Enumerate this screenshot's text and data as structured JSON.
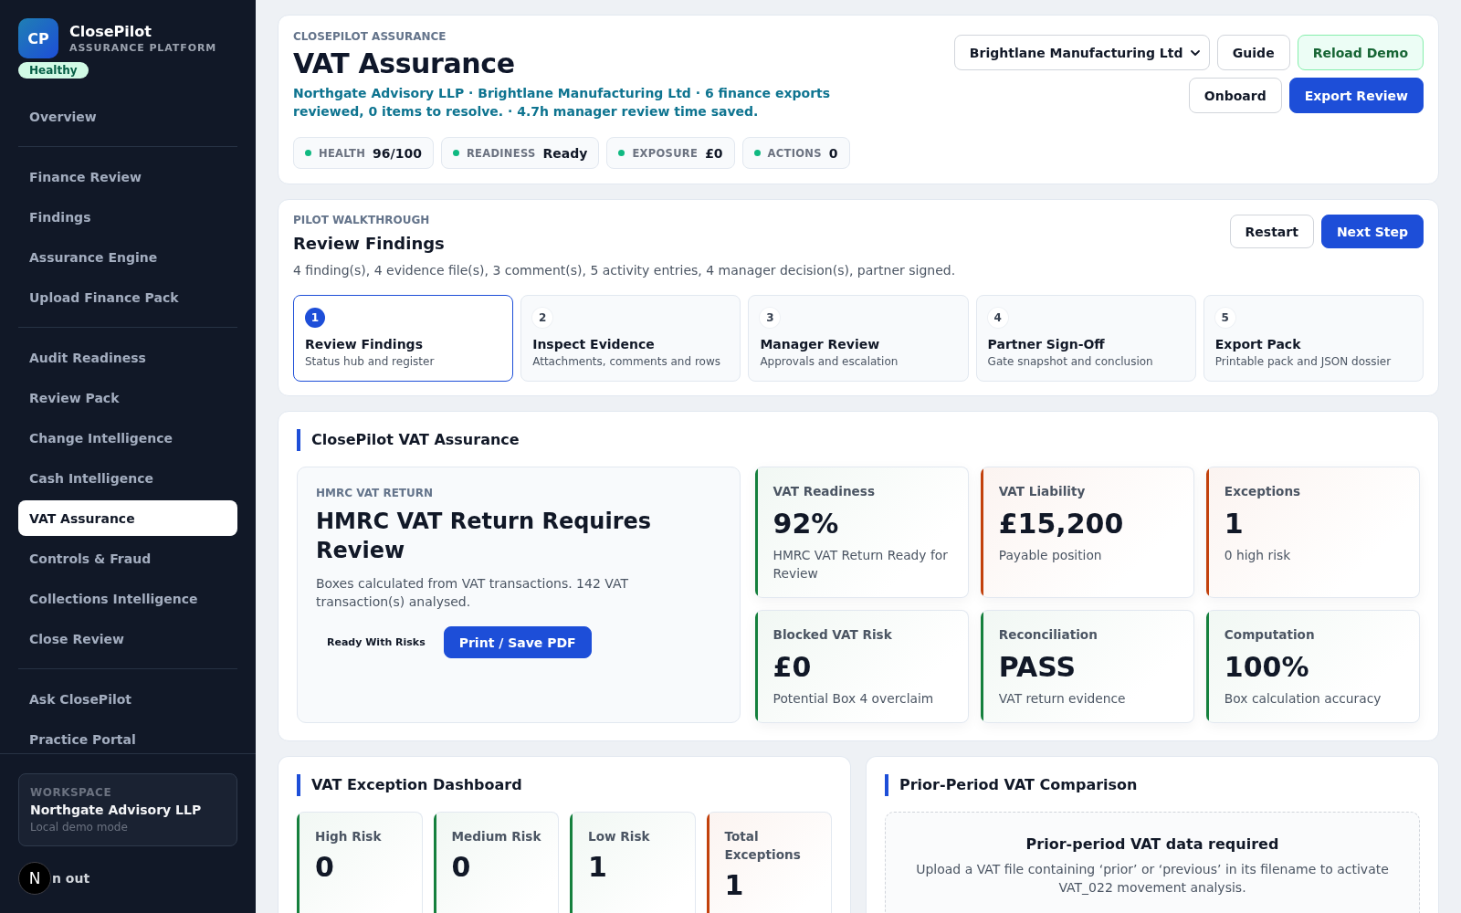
{
  "sidebar": {
    "logo": "CP",
    "brand": "ClosePilot",
    "tagline": "ASSURANCE PLATFORM",
    "status_badge": "Healthy",
    "nav_sections": [
      {
        "items": [
          {
            "label": "Overview",
            "selected": false
          }
        ]
      },
      {
        "items": [
          {
            "label": "Finance Review",
            "selected": false
          },
          {
            "label": "Findings",
            "selected": false
          },
          {
            "label": "Assurance Engine",
            "selected": false
          },
          {
            "label": "Upload Finance Pack",
            "selected": false
          }
        ]
      },
      {
        "items": [
          {
            "label": "Audit Readiness",
            "selected": false
          },
          {
            "label": "Review Pack",
            "selected": false
          },
          {
            "label": "Change Intelligence",
            "selected": false
          },
          {
            "label": "Cash Intelligence",
            "selected": false
          },
          {
            "label": "VAT Assurance",
            "selected": true
          },
          {
            "label": "Controls & Fraud",
            "selected": false
          },
          {
            "label": "Collections Intelligence",
            "selected": false
          },
          {
            "label": "Close Review",
            "selected": false
          }
        ]
      },
      {
        "items": [
          {
            "label": "Ask ClosePilot",
            "selected": false
          },
          {
            "label": "Practice Portal",
            "selected": false
          }
        ]
      }
    ],
    "workspace": {
      "label": "WORKSPACE",
      "name": "Northgate Advisory LLP",
      "mode": "Local demo mode"
    },
    "dev_tools_badge": "N",
    "sign_out": "n out"
  },
  "header": {
    "eyebrow": "CLOSEPILOT ASSURANCE",
    "title": "VAT Assurance",
    "summary": "Northgate Advisory LLP · Brightlane Manufacturing Ltd · 6 finance exports reviewed, 0 items to resolve. · 4.7h manager review time saved.",
    "company_select": {
      "value": "Brightlane Manufacturing Ltd"
    },
    "actions": [
      {
        "label": "Guide",
        "kind": "secondary"
      },
      {
        "label": "Reload Demo",
        "kind": "success"
      },
      {
        "label": "Onboard",
        "kind": "secondary"
      },
      {
        "label": "Export Review",
        "kind": "primary"
      }
    ],
    "stats": [
      {
        "label": "HEALTH",
        "value": "96/100"
      },
      {
        "label": "READINESS",
        "value": "Ready"
      },
      {
        "label": "EXPOSURE",
        "value": "£0"
      },
      {
        "label": "ACTIONS",
        "value": "0"
      }
    ]
  },
  "walkthrough": {
    "eyebrow": "PILOT WALKTHROUGH",
    "title": "Review Findings",
    "summary": "4 finding(s), 4 evidence file(s), 3 comment(s), 5 activity entries, 4 manager decision(s), partner signed.",
    "actions": [
      {
        "label": "Restart",
        "kind": "secondary"
      },
      {
        "label": "Next Step",
        "kind": "primary"
      }
    ],
    "steps": [
      {
        "number": "1",
        "title": "Review Findings",
        "subtitle": "Status hub and register",
        "selected": true
      },
      {
        "number": "2",
        "title": "Inspect Evidence",
        "subtitle": "Attachments, comments and rows",
        "selected": false
      },
      {
        "number": "3",
        "title": "Manager Review",
        "subtitle": "Approvals and escalation",
        "selected": false
      },
      {
        "number": "4",
        "title": "Partner Sign-Off",
        "subtitle": "Gate snapshot and conclusion",
        "selected": false
      },
      {
        "number": "5",
        "title": "Export Pack",
        "subtitle": "Printable pack and JSON dossier",
        "selected": false
      }
    ]
  },
  "vat_assurance": {
    "title": "ClosePilot VAT Assurance",
    "return_panel": {
      "eyebrow": "HMRC VAT RETURN",
      "title": "HMRC VAT Return Requires Review",
      "description": "Boxes calculated from VAT transactions. 142 VAT transaction(s) analysed.",
      "status": "Ready With Risks",
      "action": "Print / Save PDF"
    },
    "metrics": [
      {
        "label": "VAT Readiness",
        "value": "92%",
        "note": "HMRC VAT Return Ready for Review",
        "color": "#15803d"
      },
      {
        "label": "VAT Liability",
        "value": "£15,200",
        "note": "Payable position",
        "color": "#c2410c"
      },
      {
        "label": "Exceptions",
        "value": "1",
        "note": "0 high risk",
        "color": "#c2410c"
      },
      {
        "label": "Blocked VAT Risk",
        "value": "£0",
        "note": "Potential Box 4 overclaim",
        "color": "#15803d"
      },
      {
        "label": "Reconciliation",
        "value": "PASS",
        "note": "VAT return evidence",
        "color": "#15803d"
      },
      {
        "label": "Computation",
        "value": "100%",
        "note": "Box calculation accuracy",
        "color": "#15803d"
      }
    ]
  },
  "exception_dashboard": {
    "title": "VAT Exception Dashboard",
    "tiles": [
      {
        "label": "High Risk",
        "value": "0",
        "color": "#15803d"
      },
      {
        "label": "Medium Risk",
        "value": "0",
        "color": "#15803d"
      },
      {
        "label": "Low Risk",
        "value": "1",
        "color": "#15803d"
      },
      {
        "label": "Total Exceptions",
        "value": "1",
        "color": "#c2410c"
      }
    ]
  },
  "prior_period_comparison": {
    "title": "Prior-Period VAT Comparison",
    "empty_state": {
      "title": "Prior-period VAT data required",
      "message": "Upload a VAT file containing ‘prior’ or ‘previous’ in its filename to activate VAT_022 movement analysis."
    }
  }
}
